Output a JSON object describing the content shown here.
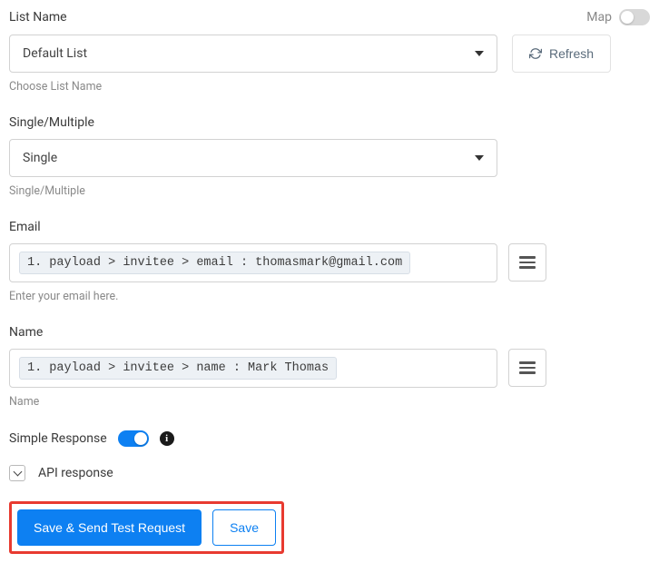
{
  "listName": {
    "label": "List Name",
    "mapLabel": "Map",
    "mapOn": false,
    "value": "Default List",
    "refreshLabel": "Refresh",
    "helper": "Choose List Name"
  },
  "singleMultiple": {
    "label": "Single/Multiple",
    "value": "Single",
    "helper": "Single/Multiple"
  },
  "email": {
    "label": "Email",
    "chip": "1. payload > invitee > email : thomasmark@gmail.com",
    "helper": "Enter your email here."
  },
  "name": {
    "label": "Name",
    "chip": "1. payload > invitee > name : Mark Thomas",
    "helper": "Name"
  },
  "simpleResponse": {
    "label": "Simple Response",
    "on": true
  },
  "apiResponse": {
    "label": "API response"
  },
  "buttons": {
    "primary": "Save & Send Test Request",
    "secondary": "Save"
  }
}
